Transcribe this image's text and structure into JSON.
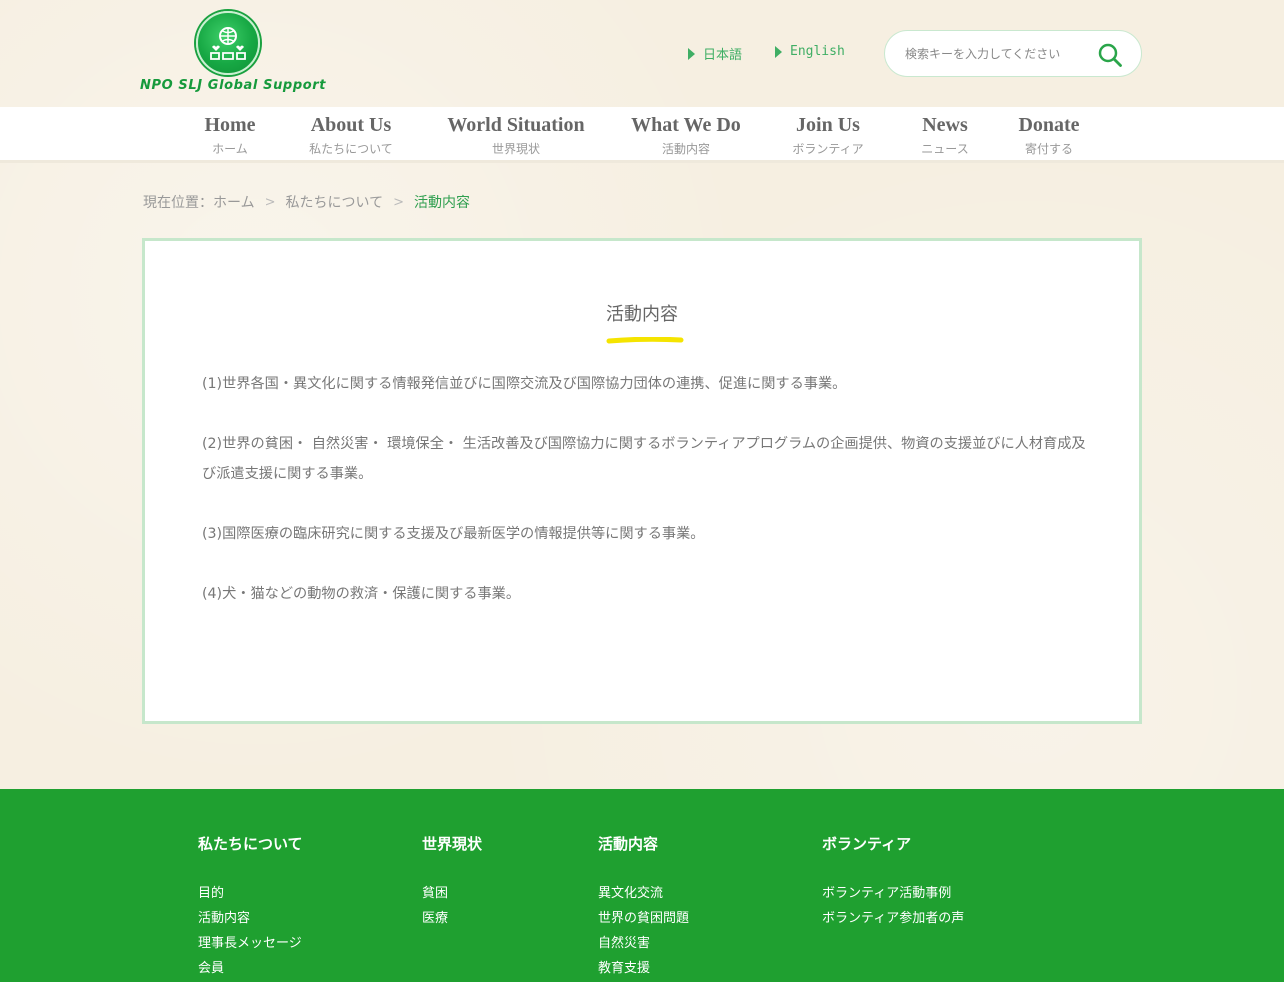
{
  "header": {
    "logo_text": "NPO SLJ Global Support",
    "languages": [
      {
        "label": "日本語"
      },
      {
        "label": "English"
      }
    ],
    "search": {
      "placeholder": "検索キーを入力してください"
    }
  },
  "nav": {
    "items": [
      {
        "en": "Home",
        "ja": "ホーム"
      },
      {
        "en": "About Us",
        "ja": "私たちについて"
      },
      {
        "en": "World Situation",
        "ja": "世界現状"
      },
      {
        "en": "What We Do",
        "ja": "活動内容"
      },
      {
        "en": "Join Us",
        "ja": "ボランティア"
      },
      {
        "en": "News",
        "ja": "ニュース"
      },
      {
        "en": "Donate",
        "ja": "寄付する"
      }
    ]
  },
  "breadcrumb": {
    "prefix": "現在位置：",
    "items": [
      "ホーム",
      "私たちについて",
      "活動内容"
    ]
  },
  "content": {
    "title": "活動内容",
    "accent_color": "#f5e400",
    "paragraphs": [
      "(1)世界各国・異文化に関する情報発信並びに国際交流及び国際協力団体の連携、促進に関する事業。",
      "(2)世界の貧困・ 自然災害・ 環境保全・ 生活改善及び国際協力に関するボランティアプログラムの企画提供、物資の支援並びに人材育成及　び派遣支援に関する事業。",
      "(3)国際医療の臨床研究に関する支援及び最新医学の情報提供等に関する事業。",
      "(4)犬・猫などの動物の救済・保護に関する事業。"
    ]
  },
  "footer": {
    "brand_color": "#1fa030",
    "columns": [
      {
        "heading": "私たちについて",
        "links": [
          "目的",
          "活動内容",
          "理事長メッセージ",
          "会員"
        ]
      },
      {
        "heading": "世界現状",
        "links": [
          "貧困",
          "医療"
        ]
      },
      {
        "heading": "活動内容",
        "links": [
          "異文化交流",
          "世界の貧困問題",
          "自然災害",
          "教育支援"
        ]
      },
      {
        "heading": "ボランティア",
        "links": [
          "ボランティア活動事例",
          "ボランティア参加者の声"
        ]
      }
    ]
  }
}
